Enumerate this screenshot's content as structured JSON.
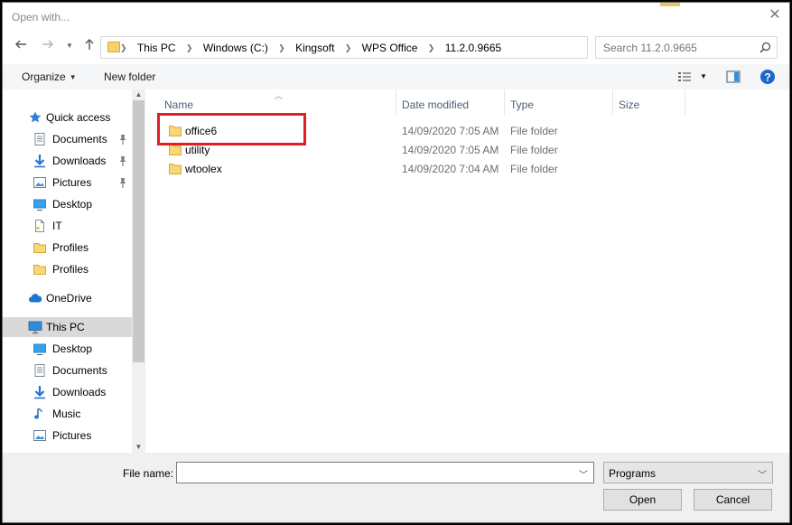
{
  "window": {
    "title": "Open with..."
  },
  "address": {
    "crumbs": [
      "This PC",
      "Windows (C:)",
      "Kingsoft",
      "WPS Office",
      "11.2.0.9665"
    ]
  },
  "search": {
    "placeholder": "Search 11.2.0.9665"
  },
  "toolbar": {
    "organize": "Organize",
    "new_folder": "New folder"
  },
  "nav": {
    "items": [
      {
        "label": "Quick access",
        "icon": "star-icon",
        "pinned": false
      },
      {
        "label": "Documents",
        "icon": "documents-icon",
        "pinned": true
      },
      {
        "label": "Downloads",
        "icon": "download-arrow-icon",
        "pinned": true
      },
      {
        "label": "Pictures",
        "icon": "pictures-icon",
        "pinned": true
      },
      {
        "label": "Desktop",
        "icon": "desktop-icon",
        "pinned": false
      },
      {
        "label": "IT",
        "icon": "document-icon",
        "pinned": false
      },
      {
        "label": "Profiles",
        "icon": "folder-icon",
        "pinned": false
      },
      {
        "label": "Profiles",
        "icon": "folder-icon",
        "pinned": false
      },
      {
        "label": "OneDrive",
        "icon": "cloud-icon",
        "pinned": false
      },
      {
        "label": "This PC",
        "icon": "computer-icon",
        "pinned": false,
        "selected": true
      },
      {
        "label": "Desktop",
        "icon": "desktop-icon",
        "pinned": false
      },
      {
        "label": "Documents",
        "icon": "documents-icon",
        "pinned": false
      },
      {
        "label": "Downloads",
        "icon": "download-arrow-icon",
        "pinned": false
      },
      {
        "label": "Music",
        "icon": "music-note-icon",
        "pinned": false
      },
      {
        "label": "Pictures",
        "icon": "pictures-icon",
        "pinned": false
      }
    ]
  },
  "list": {
    "columns": {
      "name": "Name",
      "date": "Date modified",
      "type": "Type",
      "size": "Size"
    },
    "rows": [
      {
        "name": "office6",
        "date": "14/09/2020 7:05 AM",
        "type": "File folder",
        "size": ""
      },
      {
        "name": "utility",
        "date": "14/09/2020 7:05 AM",
        "type": "File folder",
        "size": ""
      },
      {
        "name": "wtoolex",
        "date": "14/09/2020 7:04 AM",
        "type": "File folder",
        "size": ""
      }
    ]
  },
  "footer": {
    "file_name_label": "File name:",
    "file_name_value": "",
    "file_type_value": "Programs",
    "open_label": "Open",
    "cancel_label": "Cancel"
  },
  "colors": {
    "highlight": "#e01e25",
    "folder": "#f7d26b",
    "accent": "#0078d7"
  }
}
